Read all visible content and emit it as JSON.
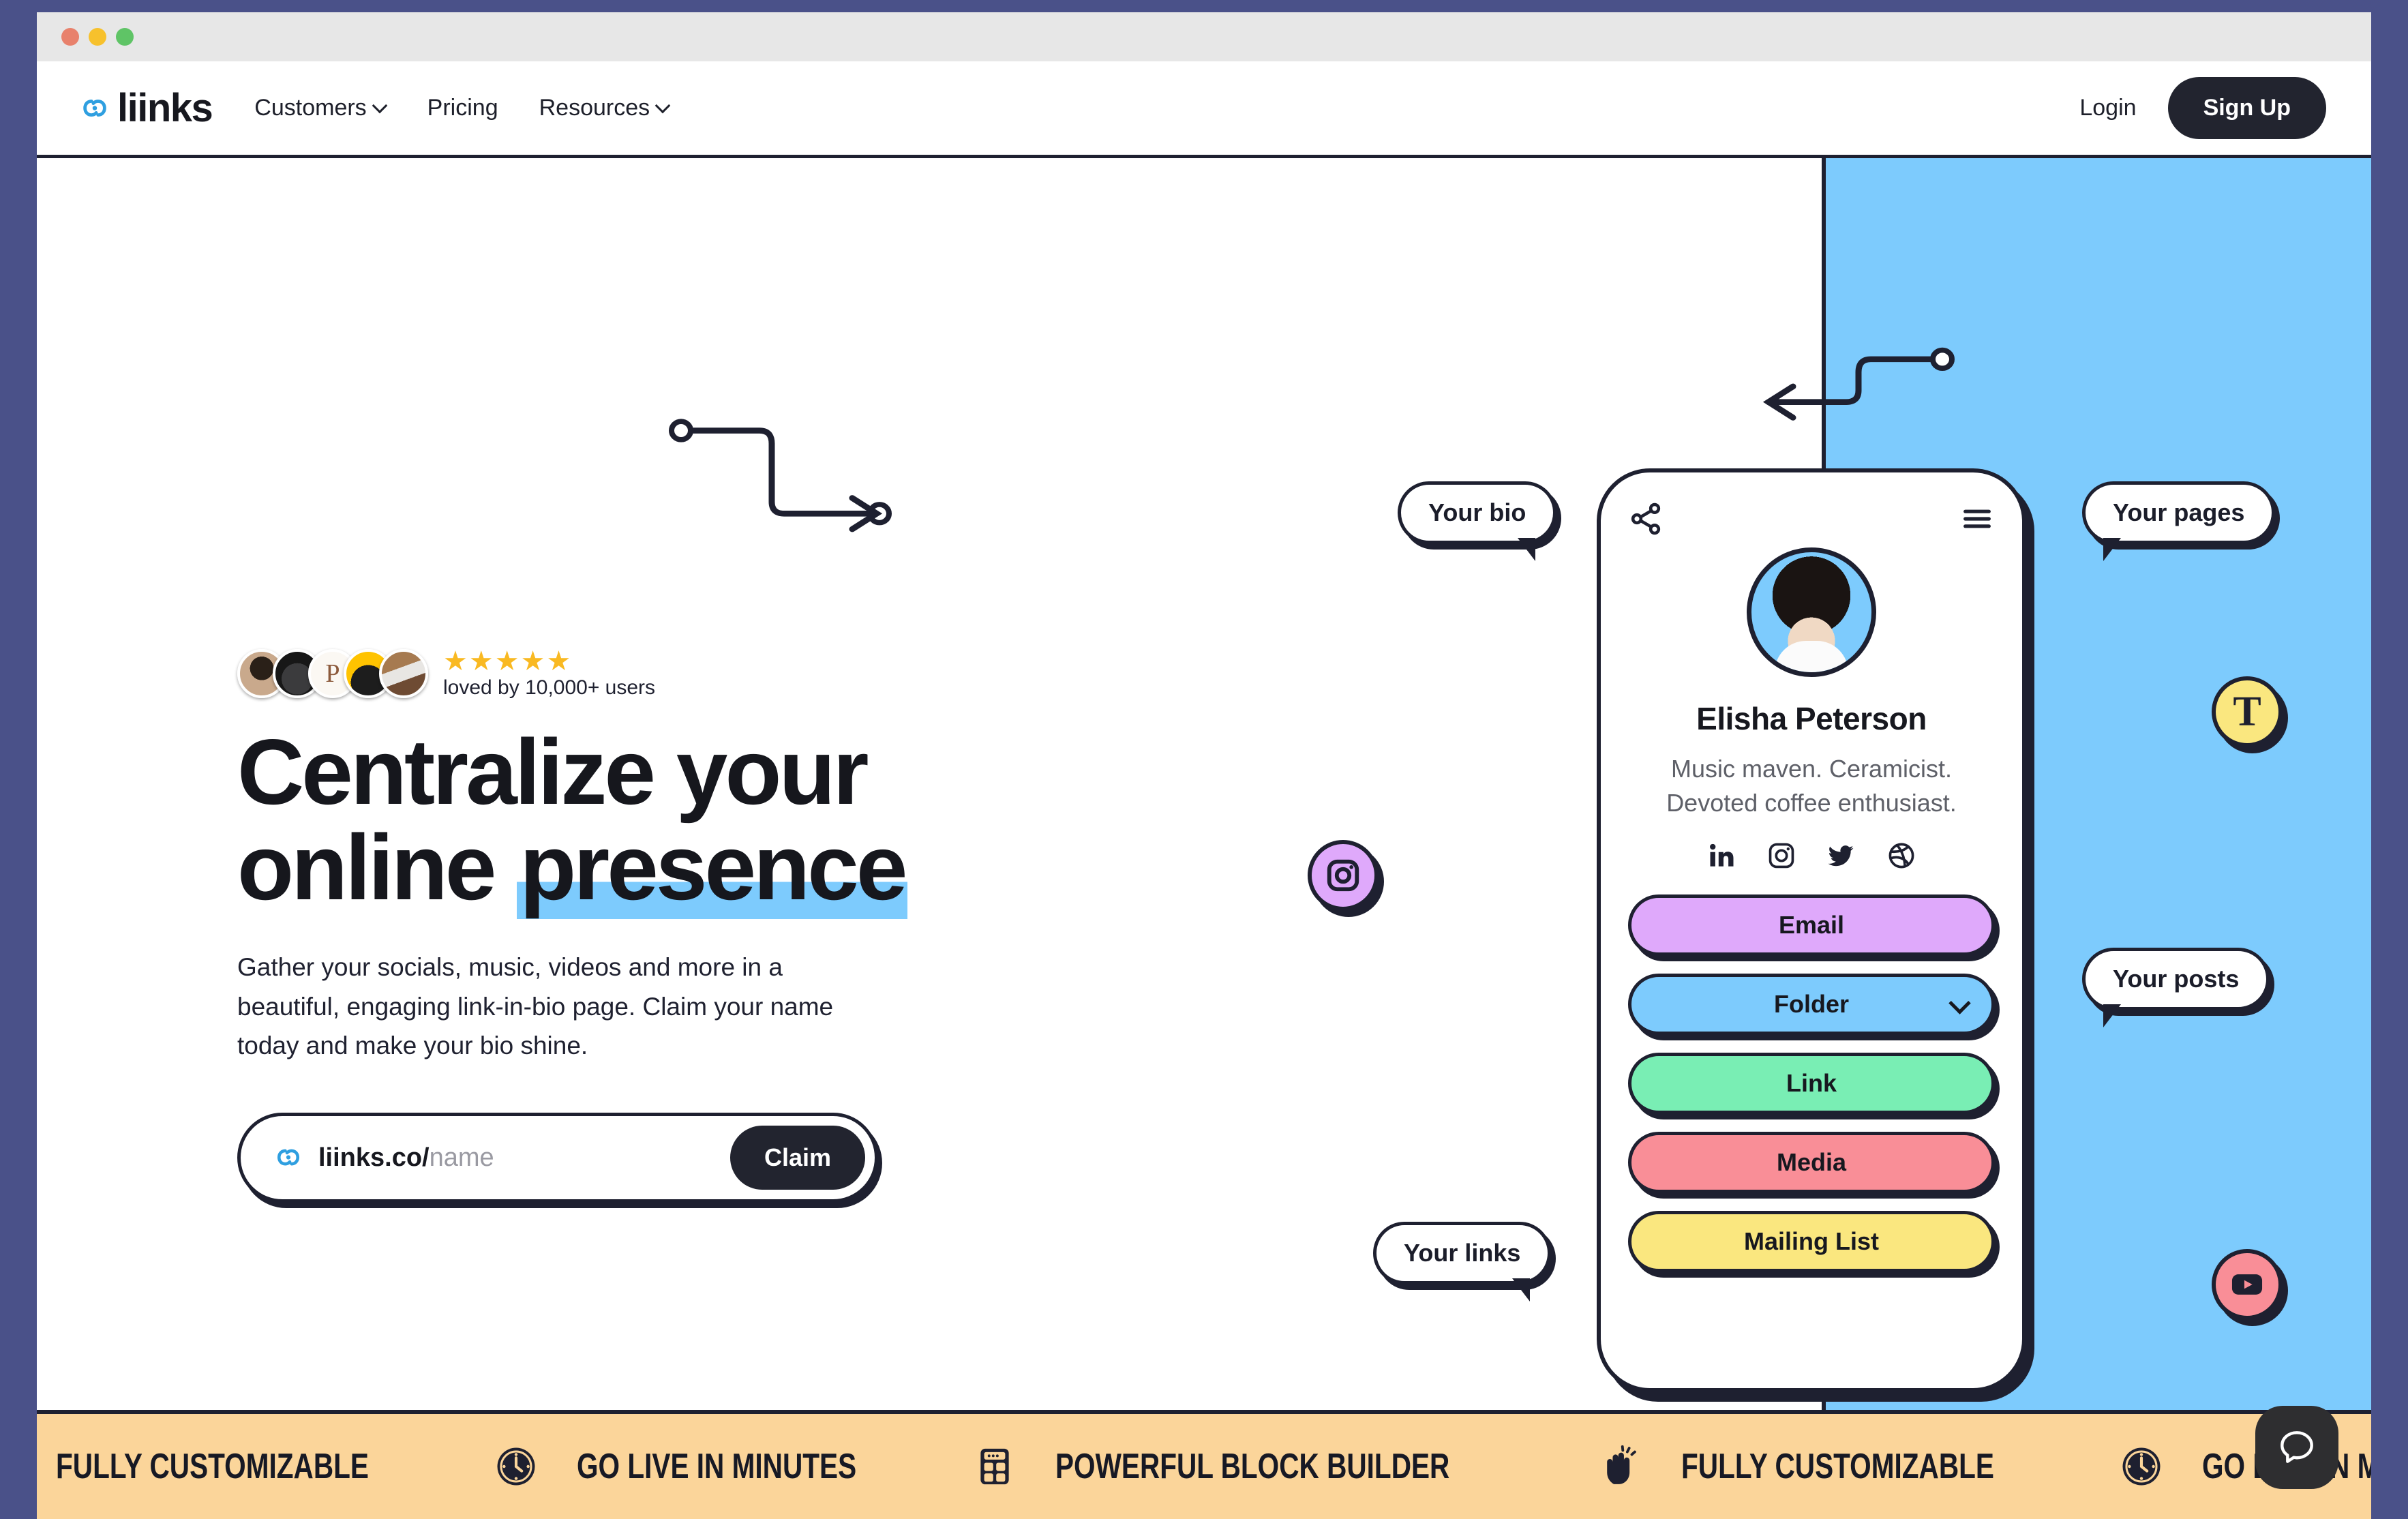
{
  "window": {
    "traffic_lights": [
      "close",
      "minimize",
      "maximize"
    ]
  },
  "nav": {
    "brand": "liinks",
    "links": [
      {
        "label": "Customers",
        "has_dropdown": true
      },
      {
        "label": "Pricing",
        "has_dropdown": false
      },
      {
        "label": "Resources",
        "has_dropdown": true
      }
    ],
    "login_label": "Login",
    "signup_label": "Sign Up"
  },
  "hero": {
    "social_proof": {
      "stars": "★★★★★",
      "caption": "loved by 10,000+ users",
      "avatar_count": 5
    },
    "headline_line1": "Centralize your",
    "headline_line2_plain": "online ",
    "headline_line2_highlight": "presence",
    "subcopy": "Gather your socials, music, videos and more in a beautiful, engaging link-in-bio page. Claim your name today and make your bio shine.",
    "claim": {
      "domain": "liinks.co/",
      "placeholder": "name",
      "button_label": "Claim"
    }
  },
  "phone": {
    "share_icon": "share-icon",
    "menu_icon": "hamburger-menu-icon",
    "profile_name": "Elisha Peterson",
    "profile_bio_line1": "Music maven. Ceramicist.",
    "profile_bio_line2": "Devoted coffee enthusiast.",
    "socials": [
      "linkedin-icon",
      "instagram-icon",
      "twitter-icon",
      "dribbble-icon"
    ],
    "link_blocks": [
      {
        "label": "Email",
        "color": "#dfa9fb",
        "dropdown": false
      },
      {
        "label": "Folder",
        "color": "#7dcbfd",
        "dropdown": true
      },
      {
        "label": "Link",
        "color": "#79eeb4",
        "dropdown": false
      },
      {
        "label": "Media",
        "color": "#f98e97",
        "dropdown": false
      },
      {
        "label": "Mailing List",
        "color": "#fae77f",
        "dropdown": false
      }
    ]
  },
  "callouts": [
    {
      "label": "Your bio",
      "tail": "right"
    },
    {
      "label": "Your pages",
      "tail": "left"
    },
    {
      "label": "Your posts",
      "tail": "left"
    },
    {
      "label": "Your links",
      "tail": "right"
    }
  ],
  "nodes": [
    {
      "icon": "instagram-icon",
      "color": "#dfa9fb"
    },
    {
      "icon": "text-t-icon",
      "color": "#fae77f"
    },
    {
      "icon": "youtube-icon",
      "color": "#f98e97"
    }
  ],
  "marquee": {
    "items": [
      {
        "text": "FULLY CUSTOMIZABLE",
        "icon": "clock-icon"
      },
      {
        "text": "GO LIVE IN MINUTES",
        "icon": "blocks-icon"
      },
      {
        "text": "POWERFUL BLOCK BUILDER",
        "icon": "waving-hand-icon"
      },
      {
        "text": "FULLY CUSTOMIZABLE",
        "icon": "clock-icon"
      },
      {
        "text": "GO LIVE IN MINUTES",
        "icon": "blocks-icon"
      }
    ]
  },
  "chat_widget": {
    "icon": "chat-bubble-icon"
  },
  "colors": {
    "page_backdrop": "#4a5189",
    "titlebar": "#e7e7e7",
    "ink": "#1e2030",
    "accent_blue": "#7dcbfd",
    "marquee_bg": "#fbd59a",
    "brand_blue": "#2f9fe0",
    "star_yellow": "#f9b922"
  }
}
